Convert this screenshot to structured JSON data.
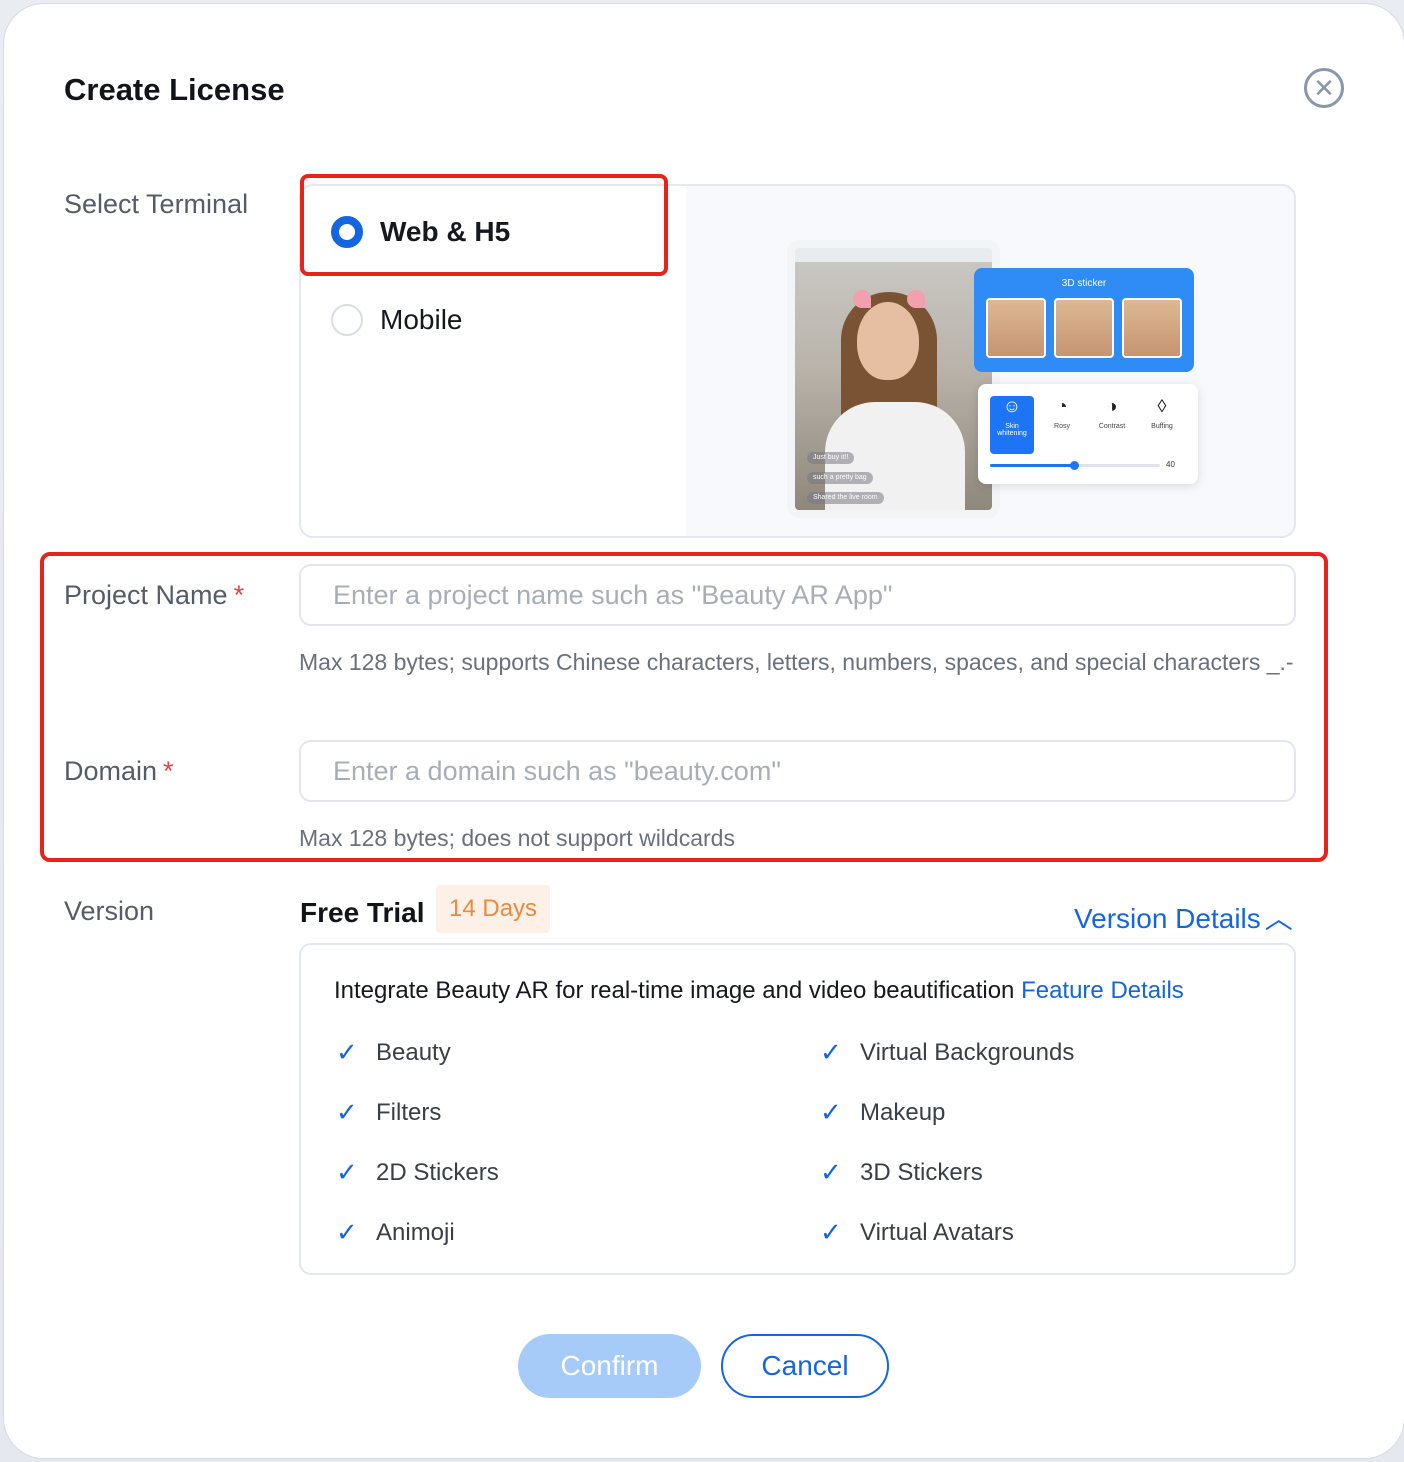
{
  "modal": {
    "title": "Create License",
    "close_icon": "close-circle-icon"
  },
  "terminal": {
    "label": "Select Terminal",
    "options": [
      {
        "label": "Web & H5",
        "selected": true
      },
      {
        "label": "Mobile",
        "selected": false
      }
    ],
    "preview": {
      "sticker_panel_title": "3D sticker",
      "chat_lines": [
        "Just buy it!!",
        "such a pretty bag",
        "Shared the live room"
      ],
      "beauty_items": [
        "Skin whitening",
        "Rosy",
        "Contrast",
        "Buffing"
      ],
      "slider_value": "40"
    }
  },
  "project_name": {
    "label": "Project Name",
    "required_mark": "*",
    "placeholder": "Enter a project name such as \"Beauty AR App\"",
    "value": "",
    "hint": "Max 128 bytes; supports Chinese characters, letters, numbers, spaces, and special characters _.-"
  },
  "domain": {
    "label": "Domain",
    "required_mark": "*",
    "placeholder": "Enter a domain such as \"beauty.com\"",
    "value": "",
    "hint": "Max 128 bytes; does not support wildcards"
  },
  "version": {
    "label": "Version",
    "name": "Free Trial",
    "badge": "14 Days",
    "details_link": "Version Details",
    "intro": "Integrate Beauty AR for real-time image and video beautification",
    "feature_link": "Feature Details",
    "features_left": [
      "Beauty",
      "Filters",
      "2D Stickers",
      "Animoji"
    ],
    "features_right": [
      "Virtual Backgrounds",
      "Makeup",
      "3D Stickers",
      "Virtual Avatars"
    ]
  },
  "buttons": {
    "confirm": "Confirm",
    "cancel": "Cancel"
  },
  "colors": {
    "primary": "#1565e0",
    "highlight": "#e8231c",
    "badge_text": "#ea8a3e",
    "confirm_disabled": "#a7cbf8"
  }
}
